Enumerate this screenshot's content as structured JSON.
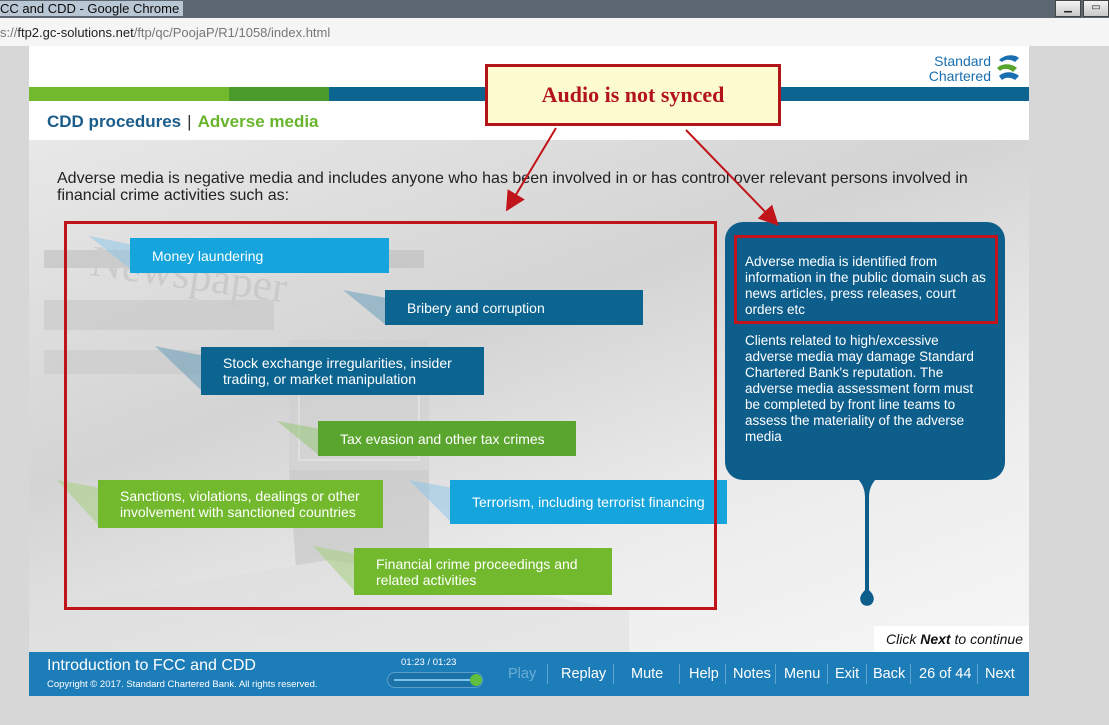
{
  "browser": {
    "window_title": "CC and CDD - Google Chrome",
    "url_prefix": "s://",
    "url_host": "ftp2.gc-solutions.net",
    "url_path": "/ftp/qc/PoojaP/R1/1058/index.html"
  },
  "brand": {
    "line1": "Standard",
    "line2": "Chartered"
  },
  "colors": {
    "blue_light": "#16a4dc",
    "blue_dark": "#0b6590",
    "green": "#5aa52e",
    "green_light": "#72b92d",
    "footer": "#1d7db8",
    "panel": "#0e5e8c",
    "annotation_red": "#c0141a"
  },
  "breadcrumb": {
    "section": "CDD procedures",
    "separator": "|",
    "topic": "Adverse media"
  },
  "intro_text": "Adverse media is negative media and includes anyone who has been involved in or has control over relevant persons involved in financial crime activities such as:",
  "crimes": [
    "Money laundering",
    "Bribery and corruption",
    "Stock exchange irregularities, insider trading, or market manipulation",
    "Tax evasion and other tax crimes",
    "Sanctions, violations, dealings or other involvement with sanctioned countries",
    "Terrorism, including terrorist financing",
    "Financial crime proceedings and related activities"
  ],
  "panel": {
    "para1": "Adverse media is identified from information in the public domain such as news articles, press releases, court orders etc",
    "para2": "Clients related to high/excessive adverse media may damage Standard Chartered Bank's reputation. The adverse media assessment form must be completed by front line teams to assess the materiality of the adverse media"
  },
  "continue_hint": {
    "pre": "Click ",
    "bold": "Next",
    "post": " to continue"
  },
  "footer": {
    "course_title": "Introduction to FCC and CDD",
    "copyright": "Copyright © 2017. Standard Chartered Bank. All rights reserved.",
    "timer": "01:23 / 01:23",
    "progress": 1.0,
    "play": "Play",
    "replay": "Replay",
    "mute": "Mute",
    "help": "Help",
    "notes": "Notes",
    "menu": "Menu",
    "exit": "Exit",
    "back": "Back",
    "page_counter": "26 of 44",
    "next": "Next"
  },
  "annotation": {
    "text": "Audio is not synced"
  }
}
